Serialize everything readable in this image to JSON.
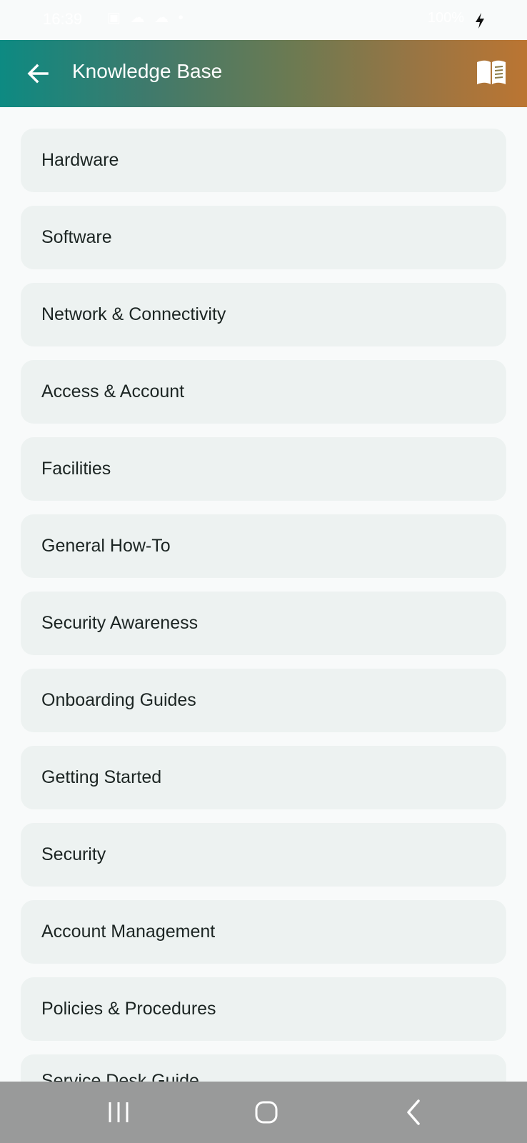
{
  "status_bar": {
    "time": "16:39",
    "notification_icons": "▣ ☁ ☁ •",
    "right_text": "100%"
  },
  "app_bar": {
    "title": "Knowledge Base",
    "back_icon": "arrow-left-icon",
    "action_icon": "book-icon"
  },
  "categories": [
    {
      "label": "Hardware"
    },
    {
      "label": "Software"
    },
    {
      "label": "Network & Connectivity"
    },
    {
      "label": "Access & Account"
    },
    {
      "label": "Facilities"
    },
    {
      "label": "General How-To"
    },
    {
      "label": "Security Awareness"
    },
    {
      "label": "Onboarding Guides"
    },
    {
      "label": "Getting Started"
    },
    {
      "label": "Security"
    },
    {
      "label": "Account Management"
    },
    {
      "label": "Policies & Procedures"
    },
    {
      "label": "Service Desk Guide"
    }
  ],
  "nav": {
    "recents_icon": "recents-icon",
    "home_icon": "home-icon",
    "back_icon": "nav-back-icon"
  },
  "colors": {
    "app_bar_start": "#0d8a82",
    "app_bar_end": "#bb7532",
    "card_bg": "#edf2f1",
    "nav_bar": "#999a9a"
  }
}
